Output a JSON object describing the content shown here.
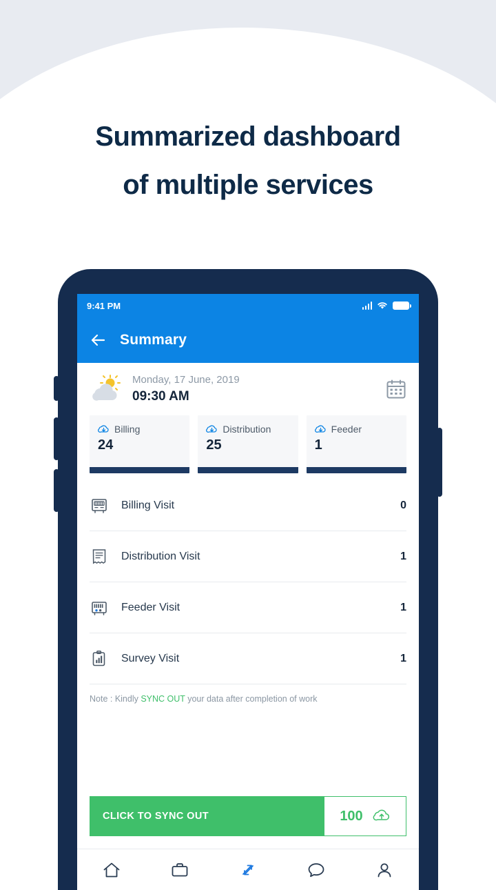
{
  "page": {
    "headline_line1": "Summarized dashboard",
    "headline_line2": "of multiple services",
    "headline_color": "#0e2a47",
    "background_top": "#e8ebf1",
    "background_main": "#ffffff"
  },
  "phone": {
    "frame_color": "#152c4e"
  },
  "status_bar": {
    "time": "9:41 PM",
    "icons": [
      "signal-bars-icon",
      "wifi-icon",
      "battery-icon"
    ],
    "background": "#0c84e4"
  },
  "app_bar": {
    "back_icon": "arrow-left-icon",
    "title": "Summary",
    "background": "#0c84e4"
  },
  "date_panel": {
    "weather_icon": "sun-cloud-icon",
    "date": "Monday, 17 June, 2019",
    "time": "09:30 AM",
    "calendar_icon": "calendar-icon"
  },
  "cards": [
    {
      "icon": "cloud-download-icon",
      "label": "Billing",
      "value": "24",
      "accent": "#1d3a63"
    },
    {
      "icon": "cloud-download-icon",
      "label": "Distribution",
      "value": "25",
      "accent": "#1d3a63"
    },
    {
      "icon": "cloud-download-icon",
      "label": "Feeder",
      "value": "1",
      "accent": "#1d3a63"
    }
  ],
  "visit_rows": [
    {
      "icon": "meter-icon",
      "label": "Billing Visit",
      "value": "0"
    },
    {
      "icon": "receipt-icon",
      "label": "Distribution Visit",
      "value": "1"
    },
    {
      "icon": "feeder-panel-icon",
      "label": "Feeder Visit",
      "value": "1"
    },
    {
      "icon": "survey-chart-icon",
      "label": "Survey Visit",
      "value": "1"
    }
  ],
  "note": {
    "prefix": "Note : Kindly ",
    "highlight": "SYNC OUT",
    "suffix": " your data after completion of work",
    "highlight_color": "#3fbf6a"
  },
  "sync_bar": {
    "button_label": "CLICK TO SYNC OUT",
    "count": "100",
    "icon": "cloud-upload-icon",
    "accent": "#3fbf6a"
  },
  "bottom_nav": [
    {
      "icon": "home-icon",
      "active": false
    },
    {
      "icon": "briefcase-icon",
      "active": false
    },
    {
      "icon": "sync-arrows-icon",
      "active": true
    },
    {
      "icon": "chat-icon",
      "active": false
    },
    {
      "icon": "person-icon",
      "active": false
    }
  ]
}
